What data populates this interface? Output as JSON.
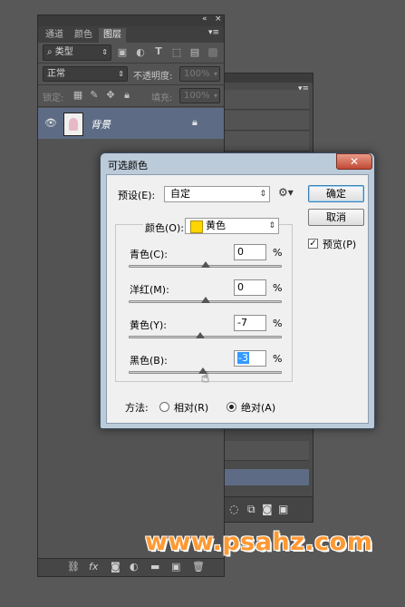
{
  "layers_panel": {
    "tabs": [
      "通道",
      "颜色",
      "图层"
    ],
    "active_tab": "图层",
    "filter_kind": "类型",
    "blend_mode": "正常",
    "opacity_label": "不透明度:",
    "opacity_value": "100%",
    "lock_label": "锁定:",
    "fill_label": "填充:",
    "fill_value": "100%",
    "layer_name": "背景"
  },
  "dialog": {
    "title": "可选颜色",
    "close_symbol": "✕",
    "preset_label": "预设(E):",
    "preset_value": "自定",
    "ok_label": "确定",
    "cancel_label": "取消",
    "preview_label": "预览(P)",
    "preview_checked": true,
    "colors_label": "颜色(O):",
    "colors_value": "黄色",
    "colors_swatch": "#ffd400",
    "sliders": [
      {
        "label": "青色(C):",
        "value": "0",
        "unit": "%",
        "level": 0.5
      },
      {
        "label": "洋红(M):",
        "value": "0",
        "unit": "%",
        "level": 0.5
      },
      {
        "label": "黄色(Y):",
        "value": "-7",
        "unit": "%",
        "level": 0.465
      },
      {
        "label": "黑色(B):",
        "value": "-3",
        "unit": "%",
        "level": 0.485
      }
    ],
    "method_label": "方法:",
    "method_relative": "相对(R)",
    "method_absolute": "绝对(A)",
    "method_selected": "absolute"
  },
  "watermark": "www.psahz.com"
}
